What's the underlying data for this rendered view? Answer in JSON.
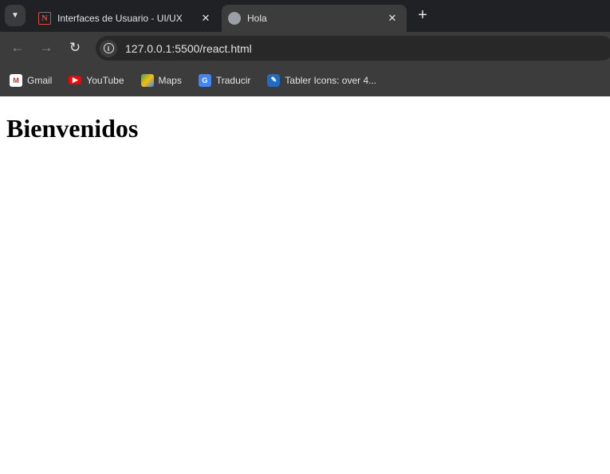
{
  "tabs": [
    {
      "title": "Interfaces de Usuario - UI/UX",
      "icon": "notion-icon",
      "active": false
    },
    {
      "title": "Hola",
      "icon": "globe-icon",
      "active": true
    }
  ],
  "toolbar": {
    "url": "127.0.0.1:5500/react.html"
  },
  "bookmarks": [
    {
      "label": "Gmail",
      "icon": "gmail-icon"
    },
    {
      "label": "YouTube",
      "icon": "youtube-icon"
    },
    {
      "label": "Maps",
      "icon": "maps-icon"
    },
    {
      "label": "Traducir",
      "icon": "translate-icon"
    },
    {
      "label": "Tabler Icons: over 4...",
      "icon": "tabler-icon"
    }
  ],
  "page": {
    "heading": "Bienvenidos"
  },
  "colors": {
    "tabstrip": "#202124",
    "toolbar": "#3c3c3c",
    "omnibox": "#282828"
  }
}
